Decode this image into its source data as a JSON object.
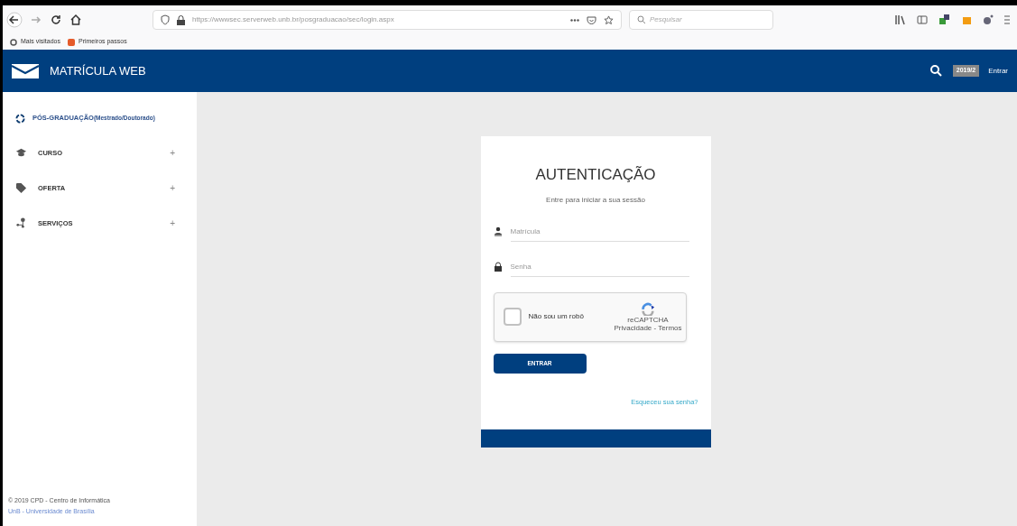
{
  "browser": {
    "url": "https://wwwsec.serverweb.unb.br/posgraduacao/sec/login.aspx",
    "search": {
      "placeholder": "Pesquisar"
    },
    "bookmarks": [
      "Mais visitados",
      "Primeiros passos"
    ]
  },
  "header": {
    "title": "MATRÍCULA WEB",
    "period": "2019/2",
    "login": "Entrar"
  },
  "sidebar": {
    "heading": "PÓS-GRADUAÇÃO",
    "heading_note": "(Mestrado/Doutorado)",
    "items": [
      {
        "label": "CURSO",
        "expander": "+",
        "kind": "course"
      },
      {
        "label": "OFERTA",
        "expander": "+",
        "kind": "offer"
      },
      {
        "label": "SERVIÇOS",
        "expander": "+",
        "kind": "services"
      }
    ],
    "footer": [
      "© 2019 CPD - Centro de Informática",
      "UnB - Universidade de Brasília"
    ]
  },
  "login": {
    "title": "AUTENTICAÇÃO",
    "subtitle": "Entre para iniciar a sua sessão",
    "fields": [
      {
        "placeholder": "Matrícula",
        "kind": "user"
      },
      {
        "placeholder": "Senha",
        "kind": "password"
      }
    ],
    "captcha": {
      "label": "Não sou um robô",
      "checked": false,
      "brand": "reCAPTCHA",
      "links": "Privacidade - Termos"
    },
    "button": "ENTRAR",
    "forgot": "Esqueceu sua senha?"
  }
}
